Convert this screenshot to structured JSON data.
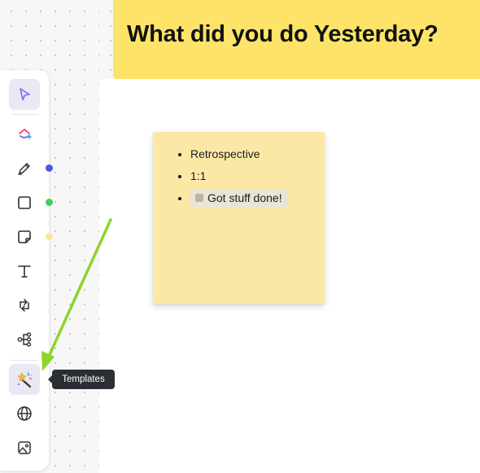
{
  "banner": {
    "title": "What did you do Yesterday?"
  },
  "toolbar": {
    "tools": [
      {
        "icon": "cursor-icon",
        "name": "select"
      },
      {
        "icon": "clickup-logo-icon",
        "name": "clickup"
      },
      {
        "icon": "pen-icon",
        "name": "draw"
      },
      {
        "icon": "square-icon",
        "name": "shape"
      },
      {
        "icon": "sticky-note-icon",
        "name": "sticky-note"
      },
      {
        "icon": "text-icon",
        "name": "text"
      },
      {
        "icon": "connector-icon",
        "name": "connector"
      },
      {
        "icon": "mind-map-icon",
        "name": "mind-map"
      },
      {
        "icon": "magic-wand-icon",
        "name": "templates"
      },
      {
        "icon": "globe-icon",
        "name": "embed"
      },
      {
        "icon": "image-icon",
        "name": "image"
      }
    ],
    "color_dots": {
      "pen": "#4f56e6",
      "shape": "#3fd15a",
      "sticky": "#f8e7a6"
    },
    "tooltip": "Templates"
  },
  "sticky_note": {
    "color": "#fce8a6",
    "items": [
      "Retrospective",
      "1:1"
    ],
    "chip": "Got stuff done!"
  },
  "colors": {
    "banner": "#fde468",
    "arrow": "#8fd32c",
    "accent": "#7b68ee"
  }
}
